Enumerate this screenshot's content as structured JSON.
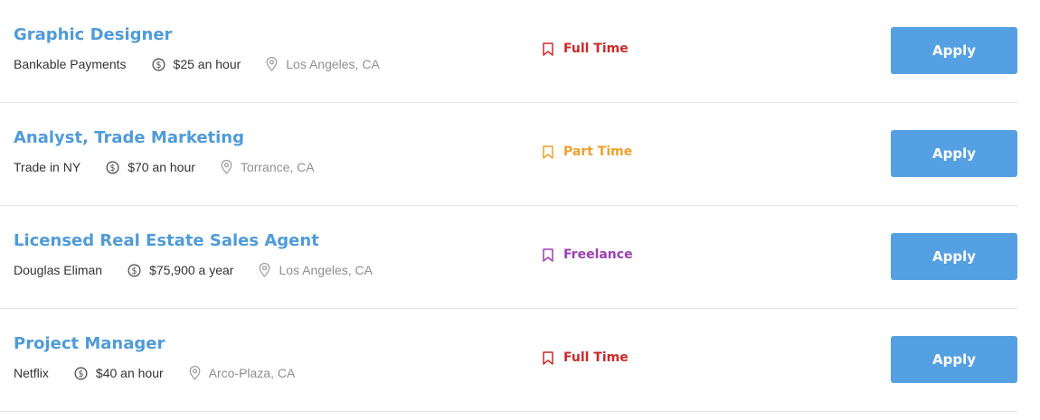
{
  "colors": {
    "title": "#4f9bd8",
    "apply_bg": "#54a0e3",
    "full_time": "#cc2a2a",
    "part_time": "#f0a02c",
    "freelance": "#9b3fb0"
  },
  "jobs": [
    {
      "title": "Graphic Designer",
      "company": "Bankable Payments",
      "salary": "$25 an hour",
      "location": "Los Angeles, CA",
      "type": "Full Time",
      "type_color": "#cc2a2a",
      "apply_label": "Apply",
      "salary_icon": "dollar-circle-icon",
      "location_icon": "map-pin-icon",
      "type_icon": "bookmark-icon"
    },
    {
      "title": "Analyst, Trade Marketing",
      "company": "Trade in NY",
      "salary": "$70 an hour",
      "location": "Torrance, CA",
      "type": "Part Time",
      "type_color": "#f0a02c",
      "apply_label": "Apply",
      "salary_icon": "dollar-circle-icon",
      "location_icon": "map-pin-icon",
      "type_icon": "bookmark-icon"
    },
    {
      "title": "Licensed Real Estate Sales Agent",
      "company": "Douglas Eliman",
      "salary": "$75,900 a year",
      "location": "Los Angeles, CA",
      "type": "Freelance",
      "type_color": "#9b3fb0",
      "apply_label": "Apply",
      "salary_icon": "dollar-circle-icon",
      "location_icon": "map-pin-icon",
      "type_icon": "bookmark-icon"
    },
    {
      "title": "Project Manager",
      "company": "Netflix",
      "salary": "$40 an hour",
      "location": "Arco-Plaza, CA",
      "type": "Full Time",
      "type_color": "#cc2a2a",
      "apply_label": "Apply",
      "salary_icon": "dollar-circle-icon",
      "location_icon": "map-pin-icon",
      "type_icon": "bookmark-icon"
    }
  ]
}
